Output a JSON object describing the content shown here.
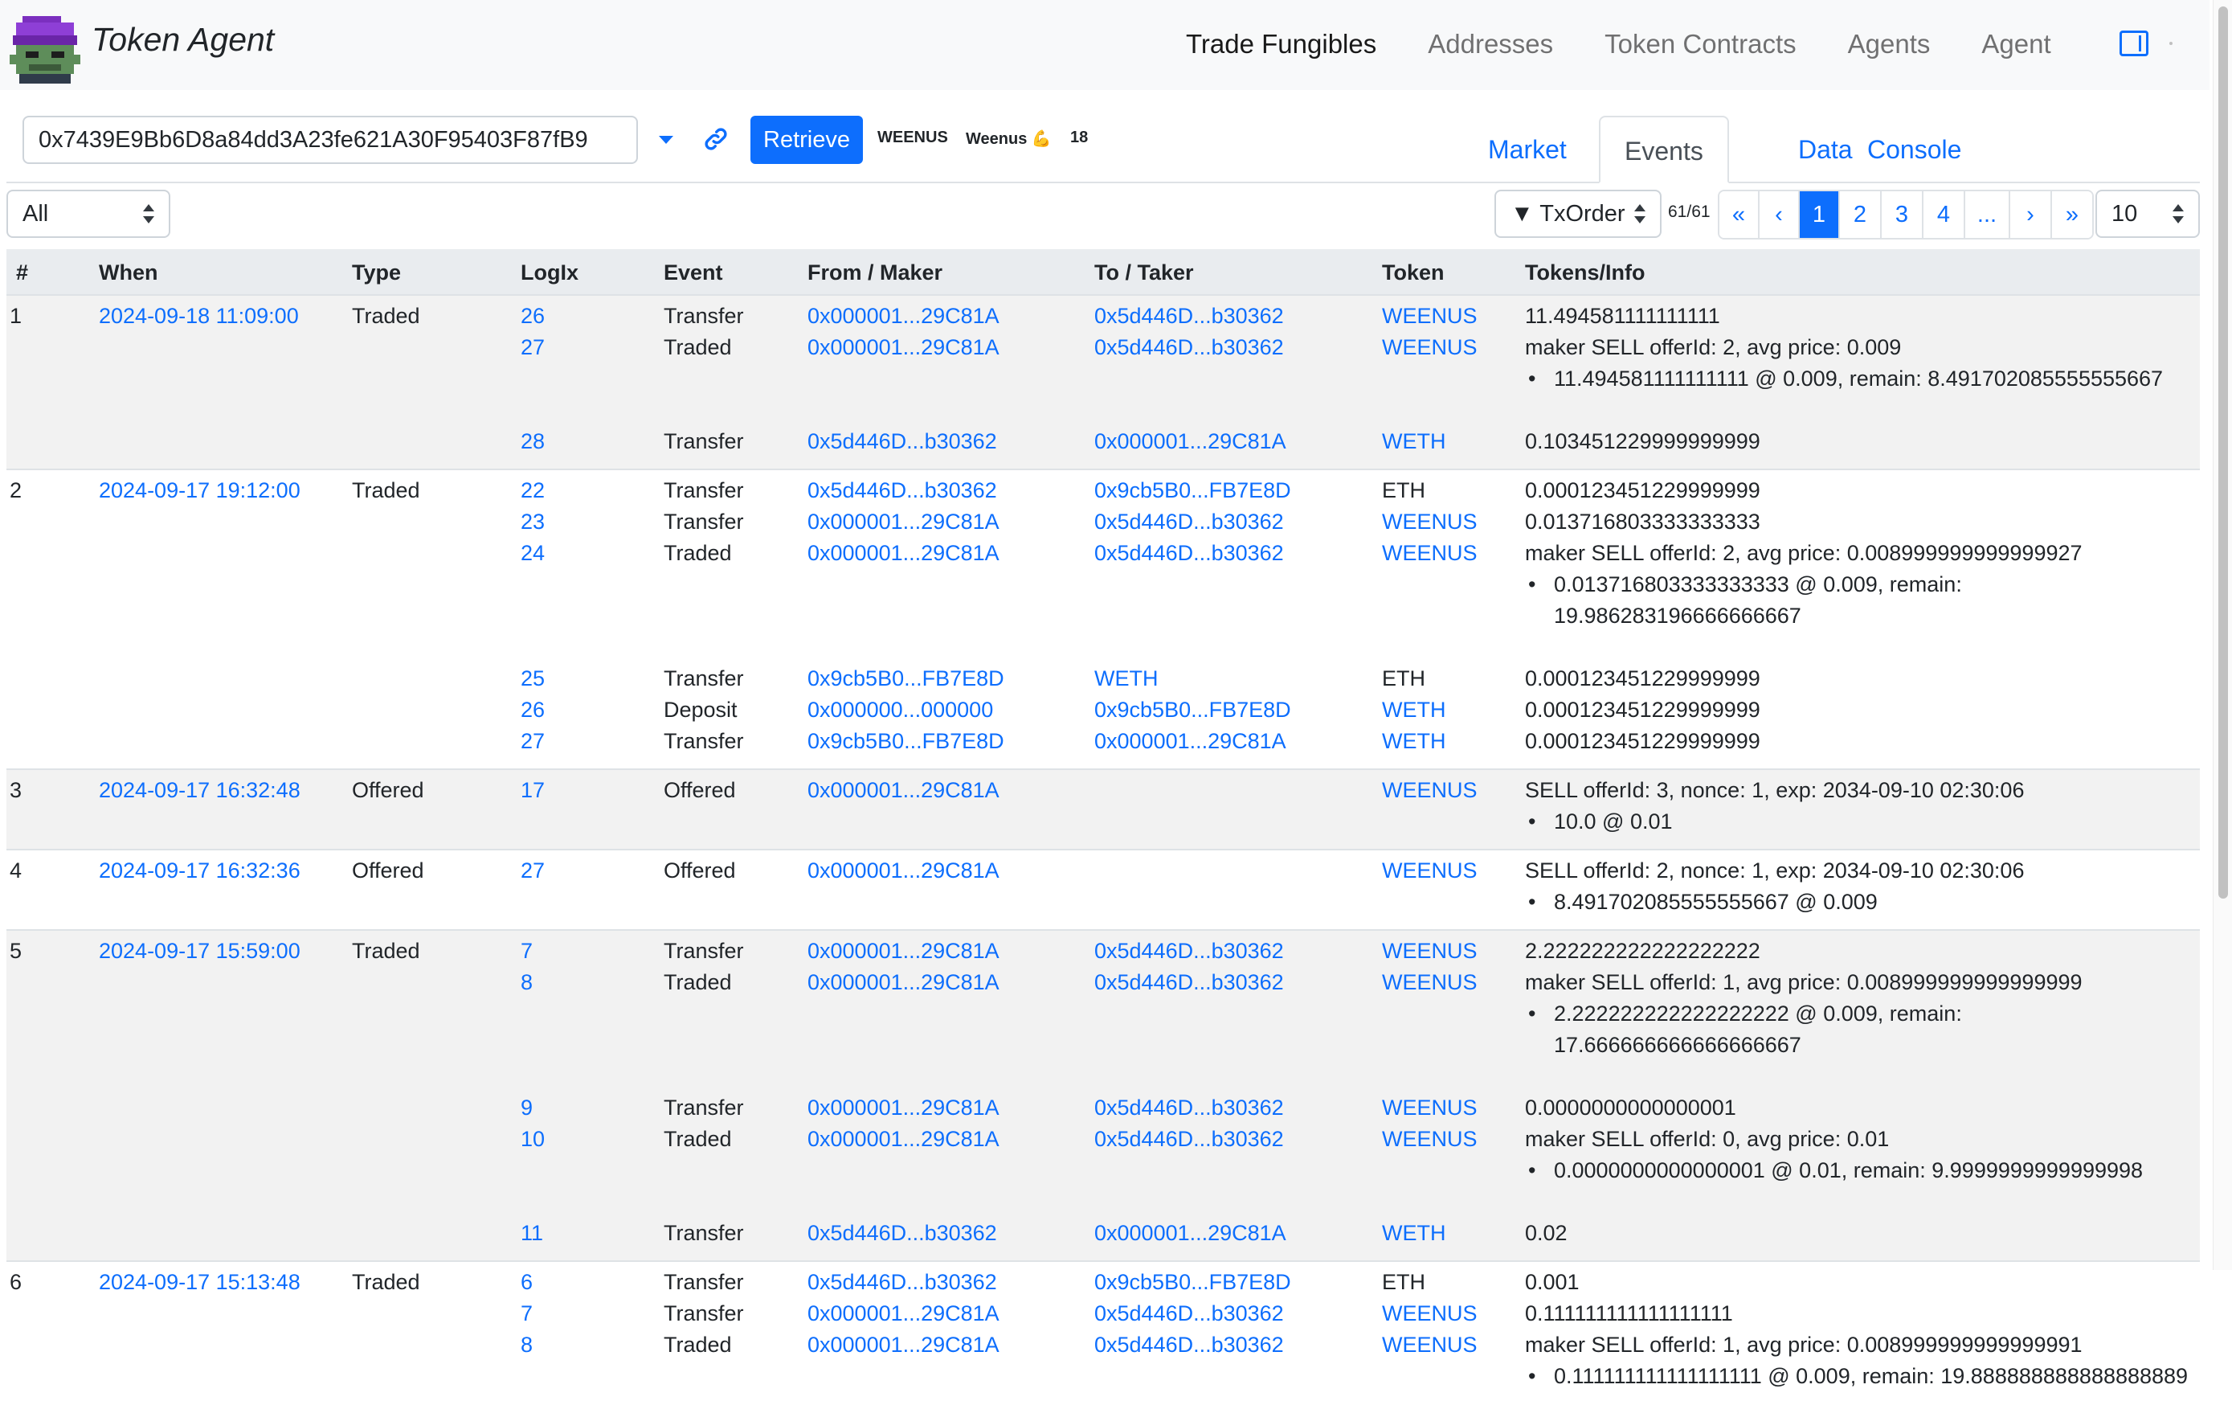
{
  "app": {
    "title": "Token Agent",
    "nav": [
      "Trade Fungibles",
      "Addresses",
      "Token Contracts",
      "Agents",
      "Agent"
    ],
    "active_nav": "Trade Fungibles"
  },
  "toolbar": {
    "address_value": "0x7439E9Bb6D8a84dd3A23fe621A30F95403F87fB9",
    "retrieve_label": "Retrieve",
    "token_symbol": "WEENUS",
    "token_name": "Weenus 💪",
    "token_decimals": "18"
  },
  "tabs": [
    "Market",
    "Events",
    "Data",
    "Console"
  ],
  "active_tab": "Events",
  "filters": {
    "type_filter": "All",
    "sort": "▼ TxOrder",
    "count": "61/61",
    "pages": [
      "«",
      "‹",
      "1",
      "2",
      "3",
      "4",
      "...",
      "›",
      "»"
    ],
    "active_page": "1",
    "page_size": "10"
  },
  "table": {
    "headers": [
      "#",
      "When",
      "Type",
      "LogIx",
      "Event",
      "From / Maker",
      "To / Taker",
      "Token",
      "Tokens/Info"
    ],
    "rows": [
      {
        "num": "1",
        "when": "2024-09-18 11:09:00",
        "type": "Traded",
        "events": [
          {
            "logix": "26",
            "event": "Transfer",
            "from": "0x000001...29C81A",
            "to": "0x5d446D...b30362",
            "token": "WEENUS",
            "info": "11.494581111111111"
          },
          {
            "logix": "27",
            "event": "Traded",
            "from": "0x000001...29C81A",
            "to": "0x5d446D...b30362",
            "token": "WEENUS",
            "info": "maker SELL offerId: 2, avg price: 0.009",
            "bullets": [
              "11.494581111111111 @ 0.009, remain: 8.491702085555555667"
            ]
          },
          {
            "logix": "28",
            "event": "Transfer",
            "from": "0x5d446D...b30362",
            "to": "0x000001...29C81A",
            "token": "WETH",
            "info": "0.103451229999999999"
          }
        ]
      },
      {
        "num": "2",
        "when": "2024-09-17 19:12:00",
        "type": "Traded",
        "events": [
          {
            "logix": "22",
            "event": "Transfer",
            "from": "0x5d446D...b30362",
            "to": "0x9cb5B0...FB7E8D",
            "token": "ETH",
            "info": "0.000123451229999999"
          },
          {
            "logix": "23",
            "event": "Transfer",
            "from": "0x000001...29C81A",
            "to": "0x5d446D...b30362",
            "token": "WEENUS",
            "info": "0.013716803333333333"
          },
          {
            "logix": "24",
            "event": "Traded",
            "from": "0x000001...29C81A",
            "to": "0x5d446D...b30362",
            "token": "WEENUS",
            "info": "maker SELL offerId: 2, avg price: 0.008999999999999927",
            "bullets": [
              "0.013716803333333333 @ 0.009, remain:",
              "19.986283196666666667"
            ]
          },
          {
            "logix": "25",
            "event": "Transfer",
            "from": "0x9cb5B0...FB7E8D",
            "to": "WETH",
            "token": "ETH",
            "info": "0.000123451229999999"
          },
          {
            "logix": "26",
            "event": "Deposit",
            "from": "0x000000...000000",
            "to": "0x9cb5B0...FB7E8D",
            "token": "WETH",
            "info": "0.000123451229999999"
          },
          {
            "logix": "27",
            "event": "Transfer",
            "from": "0x9cb5B0...FB7E8D",
            "to": "0x000001...29C81A",
            "token": "WETH",
            "info": "0.000123451229999999"
          }
        ]
      },
      {
        "num": "3",
        "when": "2024-09-17 16:32:48",
        "type": "Offered",
        "events": [
          {
            "logix": "17",
            "event": "Offered",
            "from": "0x000001...29C81A",
            "to": "",
            "token": "WEENUS",
            "info": "SELL offerId: 3, nonce: 1, exp: 2034-09-10 02:30:06",
            "bullets": [
              "10.0 @ 0.01"
            ]
          }
        ]
      },
      {
        "num": "4",
        "when": "2024-09-17 16:32:36",
        "type": "Offered",
        "events": [
          {
            "logix": "27",
            "event": "Offered",
            "from": "0x000001...29C81A",
            "to": "",
            "token": "WEENUS",
            "info": "SELL offerId: 2, nonce: 1, exp: 2034-09-10 02:30:06",
            "bullets": [
              "8.491702085555555667 @ 0.009"
            ]
          }
        ]
      },
      {
        "num": "5",
        "when": "2024-09-17 15:59:00",
        "type": "Traded",
        "events": [
          {
            "logix": "7",
            "event": "Transfer",
            "from": "0x000001...29C81A",
            "to": "0x5d446D...b30362",
            "token": "WEENUS",
            "info": "2.222222222222222222"
          },
          {
            "logix": "8",
            "event": "Traded",
            "from": "0x000001...29C81A",
            "to": "0x5d446D...b30362",
            "token": "WEENUS",
            "info": "maker SELL offerId: 1, avg price: 0.008999999999999999",
            "bullets": [
              "2.222222222222222222 @ 0.009, remain:",
              "17.666666666666666667"
            ]
          },
          {
            "logix": "9",
            "event": "Transfer",
            "from": "0x000001...29C81A",
            "to": "0x5d446D...b30362",
            "token": "WEENUS",
            "info": "0.0000000000000001"
          },
          {
            "logix": "10",
            "event": "Traded",
            "from": "0x000001...29C81A",
            "to": "0x5d446D...b30362",
            "token": "WEENUS",
            "info": "maker SELL offerId: 0, avg price: 0.01",
            "bullets": [
              "0.0000000000000001 @ 0.01, remain: 9.9999999999999998"
            ]
          },
          {
            "logix": "11",
            "event": "Transfer",
            "from": "0x5d446D...b30362",
            "to": "0x000001...29C81A",
            "token": "WETH",
            "info": "0.02"
          }
        ]
      },
      {
        "num": "6",
        "when": "2024-09-17 15:13:48",
        "type": "Traded",
        "events": [
          {
            "logix": "6",
            "event": "Transfer",
            "from": "0x5d446D...b30362",
            "to": "0x9cb5B0...FB7E8D",
            "token": "ETH",
            "info": "0.001"
          },
          {
            "logix": "7",
            "event": "Transfer",
            "from": "0x000001...29C81A",
            "to": "0x5d446D...b30362",
            "token": "WEENUS",
            "info": "0.111111111111111111"
          },
          {
            "logix": "8",
            "event": "Traded",
            "from": "0x000001...29C81A",
            "to": "0x5d446D...b30362",
            "token": "WEENUS",
            "info": "maker SELL offerId: 1, avg price: 0.008999999999999991",
            "bullets": [
              "0.111111111111111111 @ 0.009, remain: 19.888888888888888889"
            ]
          }
        ]
      }
    ]
  }
}
